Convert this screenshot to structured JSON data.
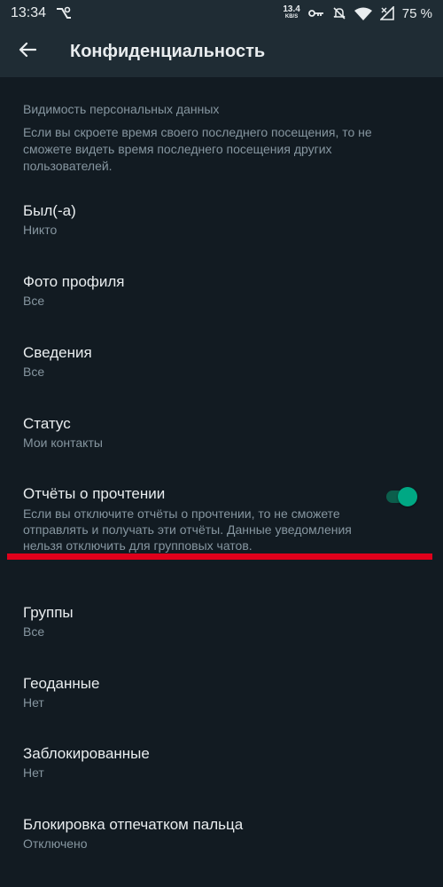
{
  "status_bar": {
    "time": "13:34",
    "net_speed_value": "13.4",
    "net_speed_unit": "KB/S",
    "battery": "75 %",
    "icons": [
      "notification-icon",
      "key-icon",
      "mute-icon",
      "wifi-icon",
      "signal-icon"
    ]
  },
  "app_bar": {
    "back_icon": "arrow-left-icon",
    "title": "Конфиденциальность"
  },
  "section": {
    "header": "Видимость персональных данных",
    "description": "Если вы скроете время своего последнего посещения, то не сможете видеть время последнего посещения других пользователей."
  },
  "settings": [
    {
      "title": "Был(-а)",
      "value": "Никто"
    },
    {
      "title": "Фото профиля",
      "value": "Все"
    },
    {
      "title": "Сведения",
      "value": "Все"
    },
    {
      "title": "Статус",
      "value": "Мои контакты"
    }
  ],
  "read_receipts": {
    "title": "Отчёты о прочтении",
    "description": "Если вы отключите отчёты о прочтении, то не сможете отправлять и получать эти отчёты. Данные уведомления нельзя отключить для групповых чатов.",
    "enabled": true
  },
  "settings_after": [
    {
      "title": "Группы",
      "value": "Все"
    },
    {
      "title": "Геоданные",
      "value": "Нет"
    },
    {
      "title": "Заблокированные",
      "value": "Нет"
    },
    {
      "title": "Блокировка отпечатком пальца",
      "value": "Отключено"
    }
  ],
  "colors": {
    "background": "#121b22",
    "app_bar": "#1f2c34",
    "accent": "#00a884",
    "annotation": "#e0001b"
  }
}
